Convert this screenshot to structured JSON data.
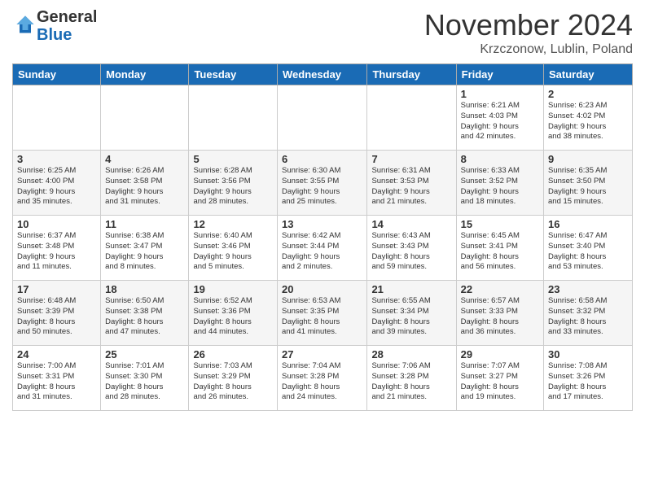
{
  "header": {
    "logo_general": "General",
    "logo_blue": "Blue",
    "month_title": "November 2024",
    "location": "Krzczonow, Lublin, Poland"
  },
  "weekdays": [
    "Sunday",
    "Monday",
    "Tuesday",
    "Wednesday",
    "Thursday",
    "Friday",
    "Saturday"
  ],
  "weeks": [
    [
      {
        "day": "",
        "info": ""
      },
      {
        "day": "",
        "info": ""
      },
      {
        "day": "",
        "info": ""
      },
      {
        "day": "",
        "info": ""
      },
      {
        "day": "",
        "info": ""
      },
      {
        "day": "1",
        "info": "Sunrise: 6:21 AM\nSunset: 4:03 PM\nDaylight: 9 hours\nand 42 minutes."
      },
      {
        "day": "2",
        "info": "Sunrise: 6:23 AM\nSunset: 4:02 PM\nDaylight: 9 hours\nand 38 minutes."
      }
    ],
    [
      {
        "day": "3",
        "info": "Sunrise: 6:25 AM\nSunset: 4:00 PM\nDaylight: 9 hours\nand 35 minutes."
      },
      {
        "day": "4",
        "info": "Sunrise: 6:26 AM\nSunset: 3:58 PM\nDaylight: 9 hours\nand 31 minutes."
      },
      {
        "day": "5",
        "info": "Sunrise: 6:28 AM\nSunset: 3:56 PM\nDaylight: 9 hours\nand 28 minutes."
      },
      {
        "day": "6",
        "info": "Sunrise: 6:30 AM\nSunset: 3:55 PM\nDaylight: 9 hours\nand 25 minutes."
      },
      {
        "day": "7",
        "info": "Sunrise: 6:31 AM\nSunset: 3:53 PM\nDaylight: 9 hours\nand 21 minutes."
      },
      {
        "day": "8",
        "info": "Sunrise: 6:33 AM\nSunset: 3:52 PM\nDaylight: 9 hours\nand 18 minutes."
      },
      {
        "day": "9",
        "info": "Sunrise: 6:35 AM\nSunset: 3:50 PM\nDaylight: 9 hours\nand 15 minutes."
      }
    ],
    [
      {
        "day": "10",
        "info": "Sunrise: 6:37 AM\nSunset: 3:48 PM\nDaylight: 9 hours\nand 11 minutes."
      },
      {
        "day": "11",
        "info": "Sunrise: 6:38 AM\nSunset: 3:47 PM\nDaylight: 9 hours\nand 8 minutes."
      },
      {
        "day": "12",
        "info": "Sunrise: 6:40 AM\nSunset: 3:46 PM\nDaylight: 9 hours\nand 5 minutes."
      },
      {
        "day": "13",
        "info": "Sunrise: 6:42 AM\nSunset: 3:44 PM\nDaylight: 9 hours\nand 2 minutes."
      },
      {
        "day": "14",
        "info": "Sunrise: 6:43 AM\nSunset: 3:43 PM\nDaylight: 8 hours\nand 59 minutes."
      },
      {
        "day": "15",
        "info": "Sunrise: 6:45 AM\nSunset: 3:41 PM\nDaylight: 8 hours\nand 56 minutes."
      },
      {
        "day": "16",
        "info": "Sunrise: 6:47 AM\nSunset: 3:40 PM\nDaylight: 8 hours\nand 53 minutes."
      }
    ],
    [
      {
        "day": "17",
        "info": "Sunrise: 6:48 AM\nSunset: 3:39 PM\nDaylight: 8 hours\nand 50 minutes."
      },
      {
        "day": "18",
        "info": "Sunrise: 6:50 AM\nSunset: 3:38 PM\nDaylight: 8 hours\nand 47 minutes."
      },
      {
        "day": "19",
        "info": "Sunrise: 6:52 AM\nSunset: 3:36 PM\nDaylight: 8 hours\nand 44 minutes."
      },
      {
        "day": "20",
        "info": "Sunrise: 6:53 AM\nSunset: 3:35 PM\nDaylight: 8 hours\nand 41 minutes."
      },
      {
        "day": "21",
        "info": "Sunrise: 6:55 AM\nSunset: 3:34 PM\nDaylight: 8 hours\nand 39 minutes."
      },
      {
        "day": "22",
        "info": "Sunrise: 6:57 AM\nSunset: 3:33 PM\nDaylight: 8 hours\nand 36 minutes."
      },
      {
        "day": "23",
        "info": "Sunrise: 6:58 AM\nSunset: 3:32 PM\nDaylight: 8 hours\nand 33 minutes."
      }
    ],
    [
      {
        "day": "24",
        "info": "Sunrise: 7:00 AM\nSunset: 3:31 PM\nDaylight: 8 hours\nand 31 minutes."
      },
      {
        "day": "25",
        "info": "Sunrise: 7:01 AM\nSunset: 3:30 PM\nDaylight: 8 hours\nand 28 minutes."
      },
      {
        "day": "26",
        "info": "Sunrise: 7:03 AM\nSunset: 3:29 PM\nDaylight: 8 hours\nand 26 minutes."
      },
      {
        "day": "27",
        "info": "Sunrise: 7:04 AM\nSunset: 3:28 PM\nDaylight: 8 hours\nand 24 minutes."
      },
      {
        "day": "28",
        "info": "Sunrise: 7:06 AM\nSunset: 3:28 PM\nDaylight: 8 hours\nand 21 minutes."
      },
      {
        "day": "29",
        "info": "Sunrise: 7:07 AM\nSunset: 3:27 PM\nDaylight: 8 hours\nand 19 minutes."
      },
      {
        "day": "30",
        "info": "Sunrise: 7:08 AM\nSunset: 3:26 PM\nDaylight: 8 hours\nand 17 minutes."
      }
    ]
  ]
}
